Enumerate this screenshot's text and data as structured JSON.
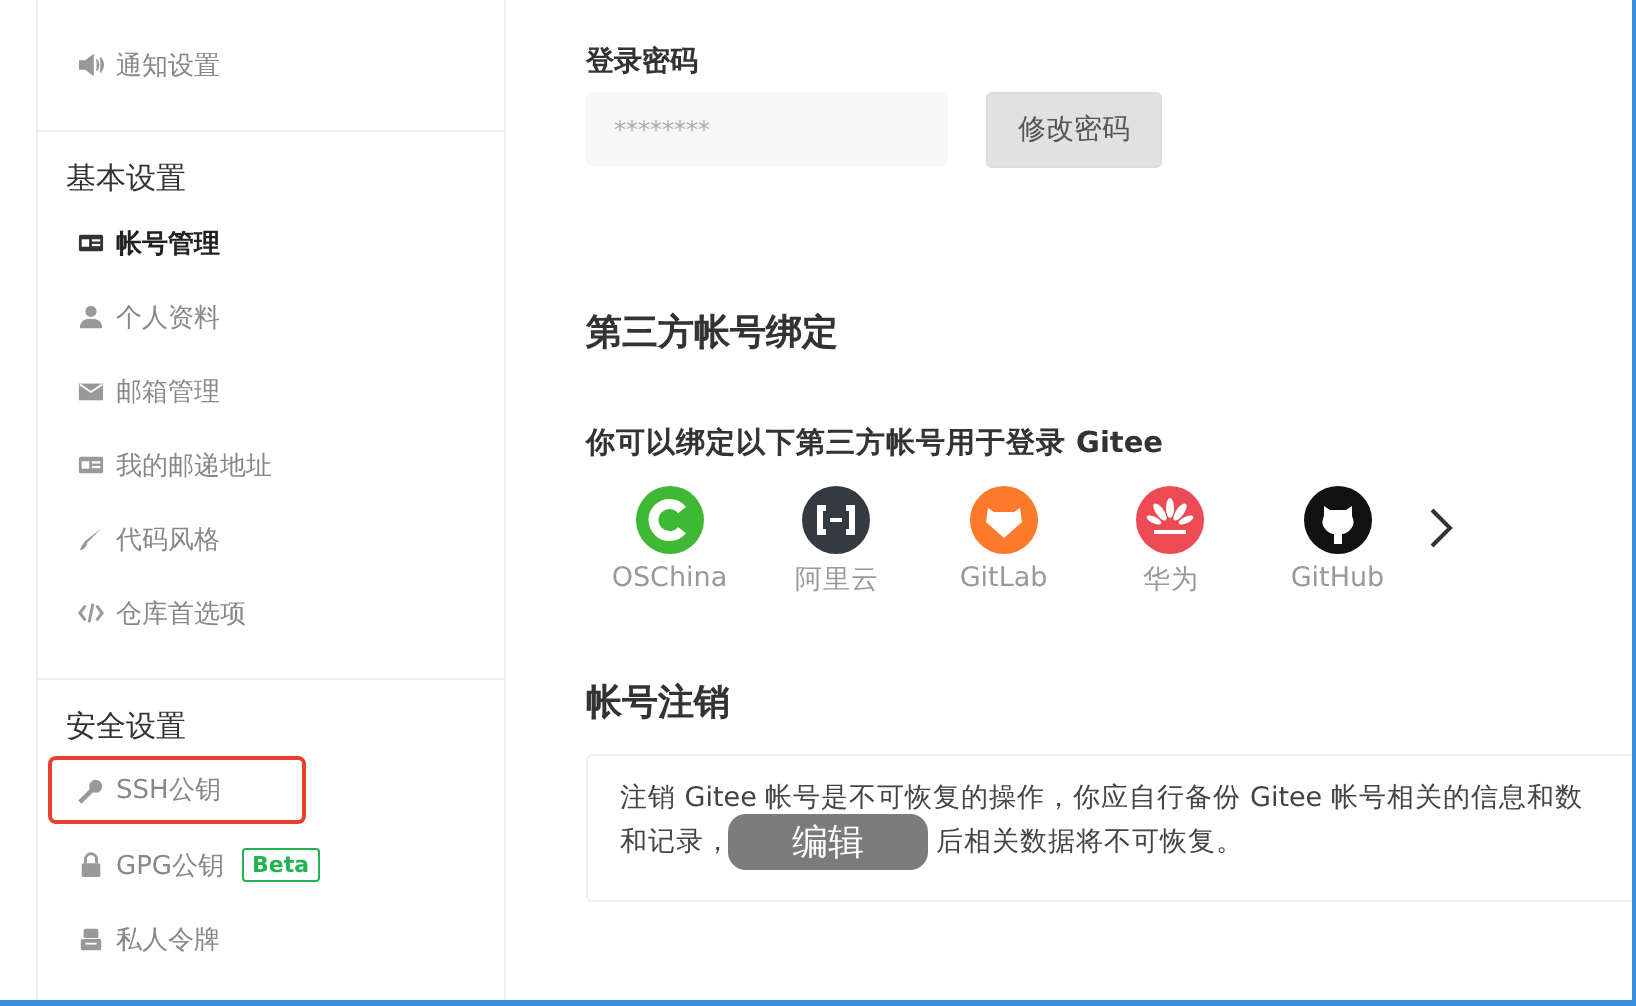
{
  "sidebar": {
    "top_items": [
      {
        "label": "通知设置",
        "selected": false,
        "highlighted": false
      }
    ],
    "sections": [
      {
        "title": "基本设置",
        "items": [
          {
            "label": "帐号管理",
            "selected": true,
            "highlighted": false
          },
          {
            "label": "个人资料",
            "selected": false,
            "highlighted": false
          },
          {
            "label": "邮箱管理",
            "selected": false,
            "highlighted": false
          },
          {
            "label": "我的邮递地址",
            "selected": false,
            "highlighted": false
          },
          {
            "label": "代码风格",
            "selected": false,
            "highlighted": false
          },
          {
            "label": "仓库首选项",
            "selected": false,
            "highlighted": false
          }
        ]
      },
      {
        "title": "安全设置",
        "items": [
          {
            "label": "SSH公钥",
            "selected": false,
            "highlighted": true
          },
          {
            "label": "GPG公钥",
            "selected": false,
            "highlighted": false,
            "badge": "Beta"
          },
          {
            "label": "私人令牌",
            "selected": false,
            "highlighted": false
          }
        ]
      }
    ]
  },
  "password": {
    "title": "登录密码",
    "value": "********",
    "button": "修改密码"
  },
  "binding": {
    "title": "第三方帐号绑定",
    "subtitle": "你可以绑定以下第三方帐号用于登录 Gitee",
    "providers": [
      {
        "label": "OSChina",
        "color": "#3fb934"
      },
      {
        "label": "阿里云",
        "color": "#343a40"
      },
      {
        "label": "GitLab",
        "color": "#fc7a2b"
      },
      {
        "label": "华为",
        "color": "#ec4b56"
      },
      {
        "label": "GitHub",
        "color": "#111111"
      }
    ]
  },
  "deactivate": {
    "title": "帐号注销",
    "line_1": "注销 Gitee 帐号是不可恢复的操作，你应自行备份 Gitee 帐号相关的信息和数",
    "line_2_start": "和记录，",
    "line_2_end": "后相关数据将不可恢复。"
  },
  "overlay_button": "编辑"
}
